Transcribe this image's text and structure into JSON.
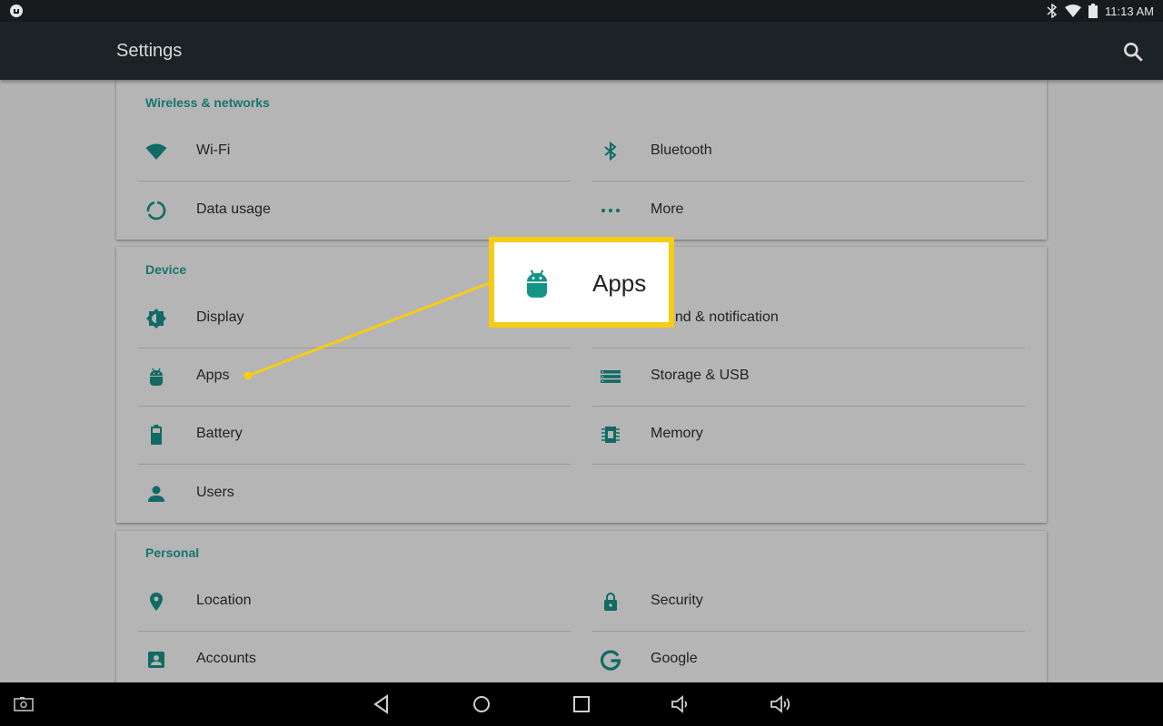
{
  "status_bar": {
    "time": "11:13 AM"
  },
  "app_bar": {
    "title": "Settings"
  },
  "sections": {
    "wireless": {
      "title": "Wireless & networks",
      "items": [
        {
          "label": "Wi-Fi",
          "icon": "wifi-icon"
        },
        {
          "label": "Bluetooth",
          "icon": "bluetooth-icon"
        },
        {
          "label": "Data usage",
          "icon": "data-usage-icon"
        },
        {
          "label": "More",
          "icon": "more-icon"
        }
      ]
    },
    "device": {
      "title": "Device",
      "items": [
        {
          "label": "Display",
          "icon": "display-icon"
        },
        {
          "label": "Sound & notification",
          "visible_text": "und & notification",
          "icon": "sound-icon"
        },
        {
          "label": "Apps",
          "icon": "android-icon"
        },
        {
          "label": "Storage & USB",
          "icon": "storage-icon"
        },
        {
          "label": "Battery",
          "icon": "battery-icon"
        },
        {
          "label": "Memory",
          "icon": "memory-icon"
        },
        {
          "label": "Users",
          "icon": "person-icon"
        }
      ]
    },
    "personal": {
      "title": "Personal",
      "items": [
        {
          "label": "Location",
          "icon": "location-icon"
        },
        {
          "label": "Security",
          "icon": "lock-icon"
        },
        {
          "label": "Accounts",
          "icon": "accounts-icon"
        },
        {
          "label": "Google",
          "icon": "google-icon"
        }
      ]
    }
  },
  "callout": {
    "label": "Apps",
    "icon": "android-icon",
    "color": "#f7cc12"
  },
  "colors": {
    "accent": "#17756e",
    "icon": "#0f6b63",
    "app_bar": "#1c2326"
  }
}
